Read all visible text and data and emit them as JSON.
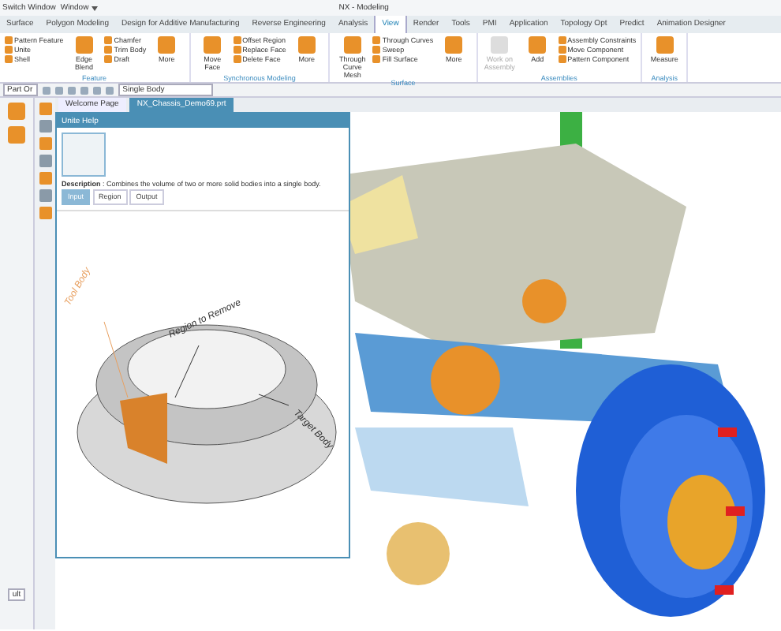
{
  "title_bar": {
    "switch_window": "Switch Window",
    "window_menu": "Window",
    "app_title": "NX - Modeling"
  },
  "ribbon_tabs": [
    {
      "label": "Surface",
      "selected": false
    },
    {
      "label": "Polygon Modeling",
      "selected": false
    },
    {
      "label": "Design for Additive Manufacturing",
      "selected": false
    },
    {
      "label": "Reverse Engineering",
      "selected": false
    },
    {
      "label": "Analysis",
      "selected": false
    },
    {
      "label": "View",
      "selected": true
    },
    {
      "label": "Render",
      "selected": false
    },
    {
      "label": "Tools",
      "selected": false
    },
    {
      "label": "PMI",
      "selected": false
    },
    {
      "label": "Application",
      "selected": false
    },
    {
      "label": "Topology Opt",
      "selected": false
    },
    {
      "label": "Predict",
      "selected": false
    },
    {
      "label": "Animation Designer",
      "selected": false
    }
  ],
  "ribbon_groups": [
    {
      "label": "Feature",
      "items": [
        {
          "kind": "small",
          "label": "Pattern Feature",
          "disabled": false
        },
        {
          "kind": "small",
          "label": "Unite",
          "disabled": false
        },
        {
          "kind": "small",
          "label": "Shell",
          "disabled": false
        },
        {
          "kind": "large",
          "label": "Edge Blend",
          "disabled": false
        },
        {
          "kind": "small",
          "label": "Chamfer",
          "disabled": false
        },
        {
          "kind": "small",
          "label": "Trim Body",
          "disabled": false
        },
        {
          "kind": "small",
          "label": "Draft",
          "disabled": false
        },
        {
          "kind": "large",
          "label": "More",
          "disabled": false
        }
      ]
    },
    {
      "label": "Synchronous Modeling",
      "items": [
        {
          "kind": "large",
          "label": "Move Face",
          "disabled": false
        },
        {
          "kind": "small",
          "label": "Offset Region",
          "disabled": false
        },
        {
          "kind": "small",
          "label": "Replace Face",
          "disabled": false
        },
        {
          "kind": "small",
          "label": "Delete Face",
          "disabled": false
        },
        {
          "kind": "large",
          "label": "More",
          "disabled": false
        }
      ]
    },
    {
      "label": "Surface",
      "items": [
        {
          "kind": "large",
          "label": "Through Curve Mesh",
          "disabled": false
        },
        {
          "kind": "small",
          "label": "Through Curves",
          "disabled": false
        },
        {
          "kind": "small",
          "label": "Sweep",
          "disabled": false
        },
        {
          "kind": "small",
          "label": "Fill Surface",
          "disabled": false
        },
        {
          "kind": "large",
          "label": "More",
          "disabled": false
        }
      ]
    },
    {
      "label": "Assemblies",
      "items": [
        {
          "kind": "large",
          "label": "Work on Assembly",
          "disabled": true
        },
        {
          "kind": "large",
          "label": "Add",
          "disabled": false
        },
        {
          "kind": "small",
          "label": "Assembly Constraints",
          "disabled": false
        },
        {
          "kind": "small",
          "label": "Move Component",
          "disabled": false
        },
        {
          "kind": "small",
          "label": "Pattern Component",
          "disabled": false
        }
      ]
    },
    {
      "label": "Analysis",
      "items": [
        {
          "kind": "large",
          "label": "Measure",
          "disabled": false
        }
      ]
    }
  ],
  "toolbar": {
    "filter": "Part Or",
    "selection": "Single Body"
  },
  "sidebar": {
    "search_text": "ult"
  },
  "doc_tabs": [
    {
      "label": "Welcome Page",
      "selected": false
    },
    {
      "label": "NX_Chassis_Demo69.prt",
      "selected": true
    }
  ],
  "help_panel": {
    "title": "Unite Help",
    "description": "**Description** : Combines the volume of two or more solid bodies into a single body.",
    "buttons": [
      {
        "label": "Input",
        "selected": true
      },
      {
        "label": "Region",
        "selected": false
      },
      {
        "label": "Output",
        "selected": false
      }
    ],
    "callouts": [
      {
        "kind": "tool",
        "label": "Tool Body"
      },
      {
        "kind": "region",
        "label": "Region to Remove"
      },
      {
        "kind": "target",
        "label": "Target Body"
      }
    ]
  }
}
